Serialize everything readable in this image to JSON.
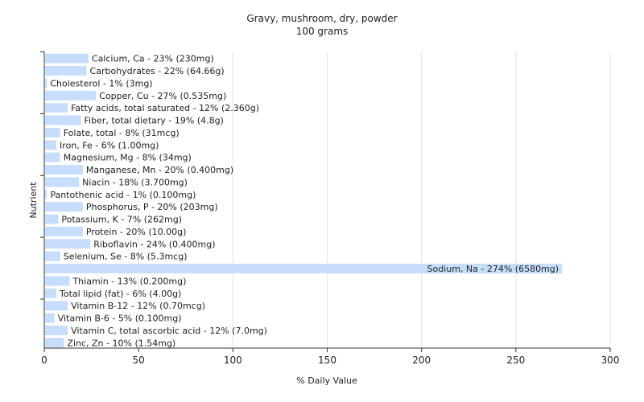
{
  "chart_data": {
    "type": "bar",
    "orientation": "horizontal",
    "title": "Gravy, mushroom, dry, powder",
    "subtitle": "100 grams",
    "xlabel": "% Daily Value",
    "ylabel": "Nutrient",
    "xlim": [
      0,
      300
    ],
    "xticks": [
      0,
      50,
      100,
      150,
      200,
      250,
      300
    ],
    "grid": true,
    "bar_color": "#c6defb",
    "categories": [
      "Calcium, Ca",
      "Carbohydrates",
      "Cholesterol",
      "Copper, Cu",
      "Fatty acids, total saturated",
      "Fiber, total dietary",
      "Folate, total",
      "Iron, Fe",
      "Magnesium, Mg",
      "Manganese, Mn",
      "Niacin",
      "Pantothenic acid",
      "Phosphorus, P",
      "Potassium, K",
      "Protein",
      "Riboflavin",
      "Selenium, Se",
      "Sodium, Na",
      "Thiamin",
      "Total lipid (fat)",
      "Vitamin B-12",
      "Vitamin B-6",
      "Vitamin C, total ascorbic acid",
      "Zinc, Zn"
    ],
    "values": [
      23,
      22,
      1,
      27,
      12,
      19,
      8,
      6,
      8,
      20,
      18,
      1,
      20,
      7,
      20,
      24,
      8,
      274,
      13,
      6,
      12,
      5,
      12,
      10
    ],
    "labels": [
      "Calcium, Ca - 23% (230mg)",
      "Carbohydrates - 22% (64.66g)",
      "Cholesterol - 1% (3mg)",
      "Copper, Cu - 27% (0.535mg)",
      "Fatty acids, total saturated - 12% (2.360g)",
      "Fiber, total dietary - 19% (4.8g)",
      "Folate, total - 8% (31mcg)",
      "Iron, Fe - 6% (1.00mg)",
      "Magnesium, Mg - 8% (34mg)",
      "Manganese, Mn - 20% (0.400mg)",
      "Niacin - 18% (3.700mg)",
      "Pantothenic acid - 1% (0.100mg)",
      "Phosphorus, P - 20% (203mg)",
      "Potassium, K - 7% (262mg)",
      "Protein - 20% (10.00g)",
      "Riboflavin - 24% (0.400mg)",
      "Selenium, Se - 8% (5.3mcg)",
      "Sodium, Na - 274% (6580mg)",
      "Thiamin - 13% (0.200mg)",
      "Total lipid (fat) - 6% (4.00g)",
      "Vitamin B-12 - 12% (0.70mcg)",
      "Vitamin B-6 - 5% (0.100mg)",
      "Vitamin C, total ascorbic acid - 12% (7.0mg)",
      "Zinc, Zn - 10% (1.54mg)"
    ]
  }
}
